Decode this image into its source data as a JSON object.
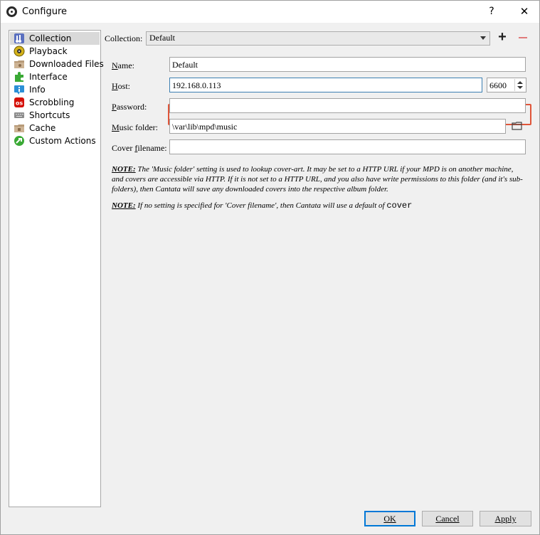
{
  "window": {
    "title": "Configure",
    "help_label": "?",
    "close_label": "✕"
  },
  "sidebar": {
    "items": [
      {
        "label": "Collection",
        "icon": "collection-icon",
        "selected": true
      },
      {
        "label": "Playback",
        "icon": "playback-icon"
      },
      {
        "label": "Downloaded Files",
        "icon": "downloaded-files-icon"
      },
      {
        "label": "Interface",
        "icon": "interface-icon"
      },
      {
        "label": "Info",
        "icon": "info-icon"
      },
      {
        "label": "Scrobbling",
        "icon": "lastfm-icon"
      },
      {
        "label": "Shortcuts",
        "icon": "keyboard-icon"
      },
      {
        "label": "Cache",
        "icon": "cache-icon"
      },
      {
        "label": "Custom Actions",
        "icon": "custom-actions-icon"
      }
    ]
  },
  "collection": {
    "label": "Collection:",
    "selected": "Default",
    "add_label": "+"
  },
  "fields": {
    "name_label": "Name:",
    "name_value": "Default",
    "host_label": "Host:",
    "host_value": "192.168.0.113",
    "port_value": "6600",
    "password_label": "Password:",
    "password_value": "",
    "music_folder_label": "Music folder:",
    "music_folder_value": "\\var\\lib\\mpd\\music",
    "cover_label": "Cover filename:",
    "cover_value": ""
  },
  "notes": {
    "note1_prefix": "NOTE:",
    "note1_text": " The 'Music folder' setting is used to lookup cover-art. It may be set to a HTTP URL if your MPD is on another machine, and covers are accessible via HTTP. If it is not set to a HTTP URL, and you also have write permissions to this folder (and it's sub-folders), then Cantata will save any downloaded covers into the respective album folder.",
    "note2_prefix": "NOTE:",
    "note2_text": " If no setting is specified for 'Cover filename', then Cantata will use a default of ",
    "note2_code": "cover"
  },
  "buttons": {
    "ok": "OK",
    "cancel": "Cancel",
    "apply": "Apply"
  },
  "colors": {
    "highlight": "#e0563a",
    "focus": "#3c7fb1",
    "default_button": "#0078d7"
  }
}
